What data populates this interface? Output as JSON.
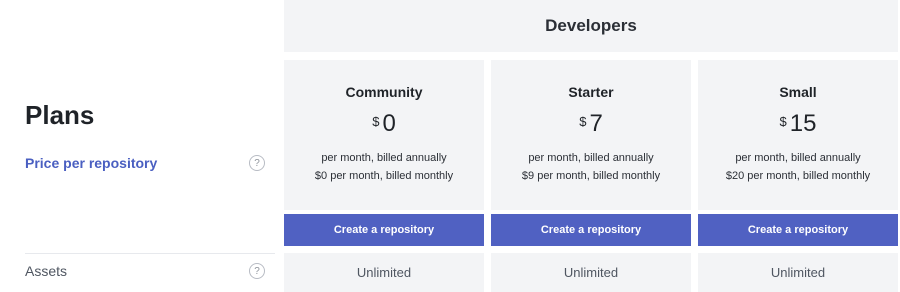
{
  "header": {
    "title": "Developers"
  },
  "left": {
    "title": "Plans",
    "price_label": "Price per repository",
    "assets_label": "Assets",
    "help_glyph": "?"
  },
  "plans": [
    {
      "name": "Community",
      "currency": "$",
      "price": "0",
      "annual_note": "per month, billed annually",
      "monthly_note": "$0 per month, billed monthly",
      "button_label": "Create a repository",
      "assets": "Unlimited"
    },
    {
      "name": "Starter",
      "currency": "$",
      "price": "7",
      "annual_note": "per month, billed annually",
      "monthly_note": "$9 per month, billed monthly",
      "button_label": "Create a repository",
      "assets": "Unlimited"
    },
    {
      "name": "Small",
      "currency": "$",
      "price": "15",
      "annual_note": "per month, billed annually",
      "monthly_note": "$20 per month, billed monthly",
      "button_label": "Create a repository",
      "assets": "Unlimited"
    }
  ],
  "colors": {
    "accent": "#5061c2",
    "panel": "#f3f4f6",
    "link": "#4a5fc1"
  }
}
